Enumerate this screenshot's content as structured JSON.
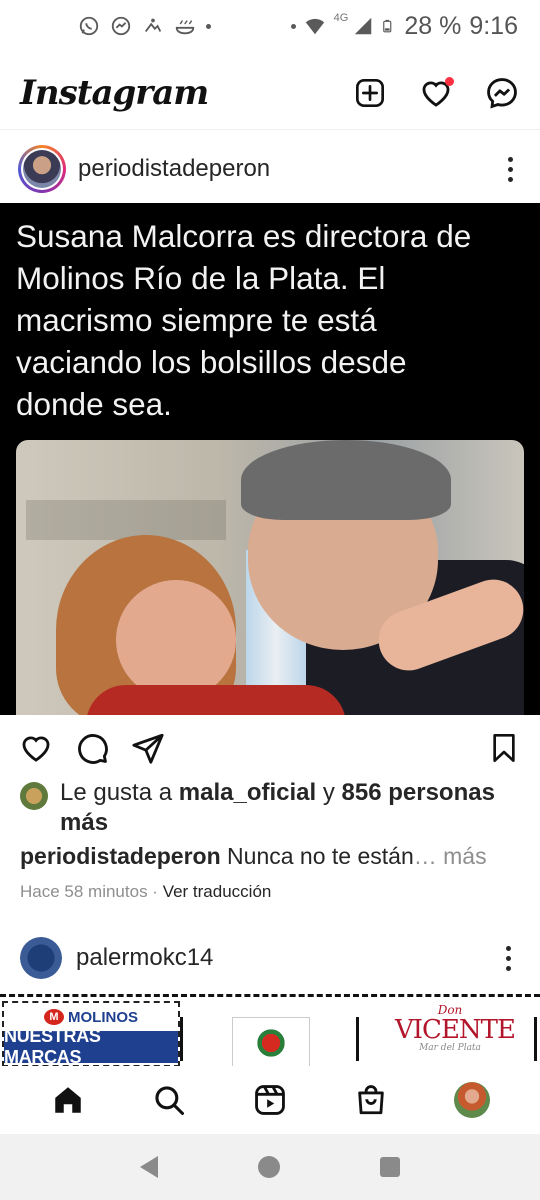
{
  "status_bar": {
    "battery": "28 %",
    "time": "9:16",
    "network": "4G",
    "icons": [
      "whatsapp-icon",
      "messenger-icon",
      "app-icon",
      "app-icon",
      "wifi-icon",
      "signal-icon",
      "battery-icon"
    ]
  },
  "header": {
    "logo": "Instagram",
    "actions": [
      "new-post-icon",
      "heart-icon",
      "messenger-icon"
    ],
    "notification_color": "#ff3040"
  },
  "post": {
    "username": "periodistadeperon",
    "image_text": "Susana Malcorra es directora de Molinos Río de la Plata. El macrismo siempre te está vaciando los bolsillos desde donde sea.",
    "likes_prefix": "Le gusta a ",
    "likes_user": "mala_oficial",
    "likes_joiner": " y ",
    "likes_count": "856 personas más",
    "caption_user": "periodistadeperon",
    "caption_text": "Nunca no te están",
    "caption_more": "… más",
    "timestamp": "Hace 58 minutos",
    "separator": " · ",
    "translate": "Ver traducción"
  },
  "post2": {
    "username": "palermokc14",
    "molinos_top": "MOLINOS",
    "molinos_bar": "NUESTRAS MARCAS",
    "vicente_don": "Don",
    "vicente_name": "VICENTE",
    "vicente_sub": "Mar del Plata"
  },
  "bottom_nav": [
    "home-icon",
    "search-icon",
    "reels-icon",
    "shop-icon",
    "profile-avatar"
  ],
  "system_nav": [
    "back",
    "home",
    "recents"
  ]
}
